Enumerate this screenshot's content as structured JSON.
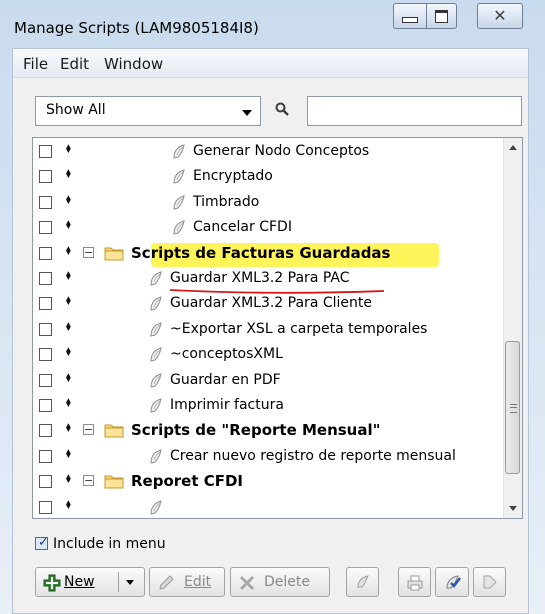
{
  "window": {
    "title": "Manage Scripts (LAM9805184I8)",
    "controls": [
      "minimize",
      "maximize",
      "close"
    ]
  },
  "menu": {
    "items": [
      "File",
      "Edit",
      "Window"
    ]
  },
  "filter": {
    "selected": "Show All",
    "search_value": ""
  },
  "tree": {
    "rows": [
      {
        "kind": "script",
        "depth": 2,
        "label": "Generar Nodo Conceptos"
      },
      {
        "kind": "script",
        "depth": 2,
        "label": "Encryptado"
      },
      {
        "kind": "script",
        "depth": 2,
        "label": "Timbrado"
      },
      {
        "kind": "script",
        "depth": 2,
        "label": "Cancelar CFDI"
      },
      {
        "kind": "folder",
        "depth": 0,
        "label": "Scripts de Facturas Guardadas",
        "expanded": true,
        "highlighted": true
      },
      {
        "kind": "script",
        "depth": 1,
        "label": "Guardar XML3.2 Para PAC",
        "underlined": true
      },
      {
        "kind": "script",
        "depth": 1,
        "label": "Guardar XML3.2 Para Cliente"
      },
      {
        "kind": "script",
        "depth": 1,
        "label": "~Exportar XSL a carpeta temporales"
      },
      {
        "kind": "script",
        "depth": 1,
        "label": "~conceptosXML"
      },
      {
        "kind": "script",
        "depth": 1,
        "label": "Guardar en PDF"
      },
      {
        "kind": "script",
        "depth": 1,
        "label": "Imprimir factura"
      },
      {
        "kind": "folder",
        "depth": 0,
        "label": "Scripts de \"Reporte Mensual\"",
        "expanded": true
      },
      {
        "kind": "script",
        "depth": 1,
        "label": "Crear nuevo registro de reporte mensual"
      },
      {
        "kind": "folder",
        "depth": 0,
        "label": "Reporet CFDI",
        "expanded": true
      },
      {
        "kind": "script",
        "depth": 1,
        "label": "",
        "partial": true
      }
    ]
  },
  "options": {
    "include_in_menu_label": "Include in menu",
    "include_in_menu_checked": true
  },
  "toolbar": {
    "new_label": "New",
    "edit_label": "Edit",
    "delete_label": "Delete"
  },
  "colors": {
    "highlight": "#fff55a",
    "annotation_underline": "#d21a1a",
    "title_gradient_top": "#c9dbee"
  }
}
